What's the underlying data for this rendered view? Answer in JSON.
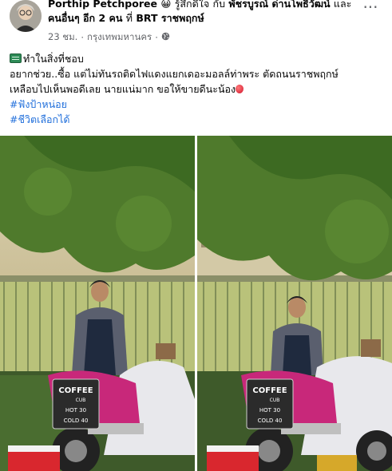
{
  "post": {
    "author": "Porthip Petchporee",
    "feeling_emoji": "😀",
    "feeling_text": "รู้สึกดีใจ",
    "with_text": "กับ",
    "tagged_person": "พัชรบูรณ์ ด่านโพธิ์วัฒน์",
    "and_text": "และ",
    "others_text": "คนอื่นๆ อีก 2 คน",
    "at_text": "ที่",
    "location": "BRT ราชพฤกษ์",
    "time": "23 ชม.",
    "separator": "·",
    "place": "กรุงเทพมหานคร",
    "more_label": "···"
  },
  "body": {
    "line1": "ทำในสิ่งที่ชอบ",
    "line2": "อยากช่วย..ซื้อ แต่ไม่ทันรถติดไฟแดงแยกเดอะมอลล์ท่าพระ ตัดถนนราชพฤกษ์",
    "line3": "เหลือบไปเห็นพอดีเลย นายแน่มาก ขอให้ขายดีนะน้อง",
    "hashtag1": "#ฟังป้าหน่อย",
    "hashtag2": "#ชีวิตเลือกได้"
  },
  "sign": {
    "title": "COFFEE",
    "sub": "CUB",
    "hot": "HOT 30",
    "cold": "COLD 40"
  },
  "icons": {
    "memo": "memo-icon",
    "balloon": "balloon-icon",
    "globe": "globe-icon",
    "more": "more-options-icon"
  },
  "colors": {
    "link": "#216fdb",
    "meta": "#65676b",
    "text": "#050505"
  }
}
